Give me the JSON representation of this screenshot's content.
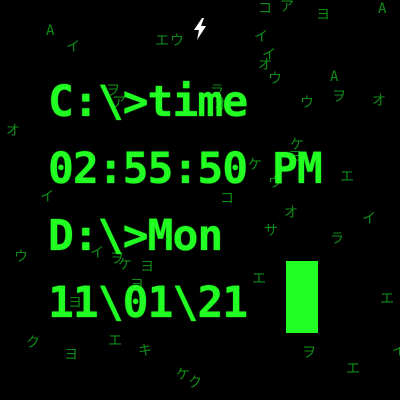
{
  "status": {
    "charging_icon": "lightning-bolt-icon"
  },
  "terminal": {
    "prompt_time": "C:\\>time",
    "time": "02:55:50 PM",
    "prompt_day": "D:\\>Mon",
    "date": "11\\01\\21"
  },
  "background_glyphs": [
    "コ",
    "ア",
    "ヨ",
    "A",
    "A",
    "エ",
    "ウ",
    "イ",
    "イ",
    "イ",
    "オ",
    "ウ",
    "A",
    "ヲ",
    "オ",
    "ヲ",
    "ア",
    "ラ",
    "オ",
    "オ",
    "ケ",
    "ケ",
    "ヨ",
    "ウ",
    "イ",
    "コ",
    "オ",
    "エ",
    "イ",
    "サ",
    "ラ",
    "ウ",
    "イ",
    "ヲ",
    "ヨ",
    "ケ",
    "ヨ",
    "エ",
    "エ",
    "ク",
    "ヨ",
    "キ",
    "エ",
    "ヲ",
    "ケ",
    "ク",
    "エ",
    "イ",
    "ウ",
    "ヨ"
  ],
  "colors": {
    "background": "#000000",
    "text": "#22ff22",
    "rain": "#0f8c17",
    "icon": "#ffffff"
  }
}
